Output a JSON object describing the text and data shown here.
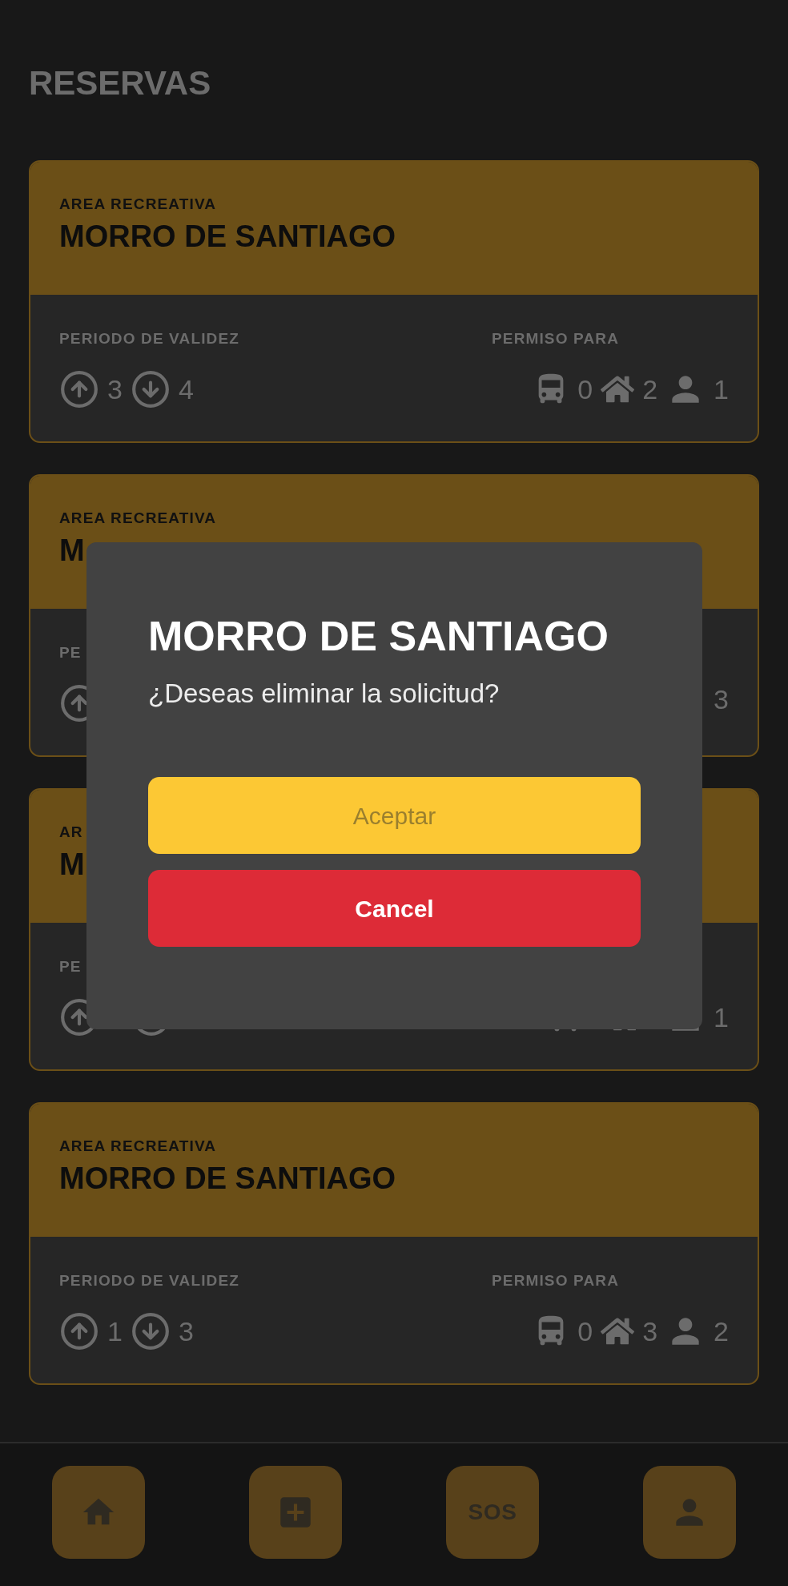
{
  "page_title": "RESERVAS",
  "cards": [
    {
      "kind": "full",
      "category": "AREA RECREATIVA",
      "title": "MORRO DE SANTIAGO",
      "validity_label": "PERIODO DE VALIDEZ",
      "start": "3",
      "end": "4",
      "permit_label": "PERMISO PARA",
      "buses": "0",
      "houses": "2",
      "people": "1"
    },
    {
      "kind": "covered_top",
      "category": "AREA RECREATIVA",
      "title": "M",
      "validity_label": "PE",
      "people": "3"
    },
    {
      "kind": "covered_middle",
      "category": "AR",
      "title": "M",
      "validity_label": "PE",
      "people": "1"
    },
    {
      "kind": "full",
      "category": "AREA RECREATIVA",
      "title": "MORRO DE SANTIAGO",
      "validity_label": "PERIODO DE VALIDEZ",
      "start": "1",
      "end": "3",
      "permit_label": "PERMISO PARA",
      "buses": "0",
      "houses": "3",
      "people": "2"
    }
  ],
  "dialog": {
    "title": "MORRO DE SANTIAGO",
    "message": "¿Deseas eliminar la solicitud?",
    "accept": "Aceptar",
    "cancel": "Cancel"
  },
  "nav": [
    {
      "kind": "home"
    },
    {
      "kind": "add"
    },
    {
      "kind": "text",
      "label": "SOS"
    },
    {
      "kind": "profile"
    }
  ]
}
